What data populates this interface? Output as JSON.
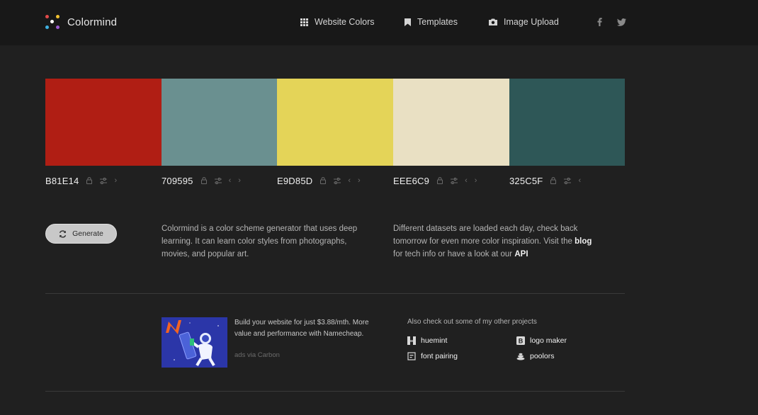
{
  "header": {
    "title": "Colormind",
    "nav": [
      {
        "label": "Website Colors",
        "icon": "grid-icon"
      },
      {
        "label": "Templates",
        "icon": "bookmark-icon"
      },
      {
        "label": "Image Upload",
        "icon": "camera-icon"
      }
    ],
    "social": [
      {
        "icon": "facebook-icon"
      },
      {
        "icon": "twitter-icon"
      }
    ]
  },
  "palette": [
    {
      "hex": "B81E14",
      "color": "#B01E14"
    },
    {
      "hex": "709595",
      "color": "#6A9090"
    },
    {
      "hex": "E9D85D",
      "color": "#E4D458"
    },
    {
      "hex": "EEE6C9",
      "color": "#E9E0C3"
    },
    {
      "hex": "325C5F",
      "color": "#2E5757"
    }
  ],
  "generate": {
    "label": "Generate"
  },
  "description": {
    "left": "Colormind is a color scheme generator that uses deep learning. It can learn color styles from photographs, movies, and popular art.",
    "right_part1": "Different datasets are loaded each day, check back tomorrow for even more color inspiration. Visit the",
    "blog_link": "blog",
    "right_part2": "for tech info or have a look at our",
    "api_link": "API"
  },
  "ad": {
    "text": "Build your website for just $3.88/mth. More value and performance with Namecheap.",
    "via": "ads via Carbon"
  },
  "other_projects": {
    "title": "Also check out some of my other projects",
    "items": [
      {
        "label": "huemint"
      },
      {
        "label": "logo maker"
      },
      {
        "label": "font pairing"
      },
      {
        "label": "poolors"
      }
    ]
  }
}
